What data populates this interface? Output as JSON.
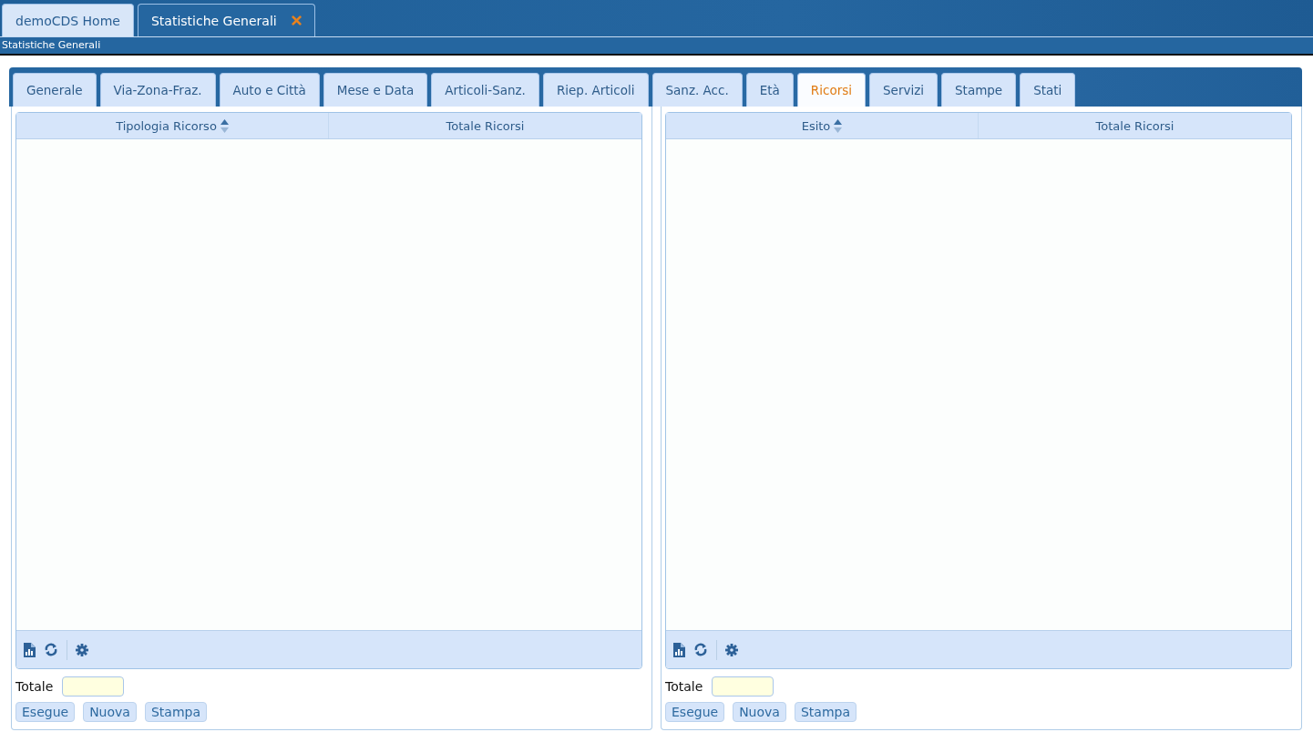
{
  "window_tabs": [
    {
      "label": "demoCDS Home",
      "selected": false,
      "closable": false
    },
    {
      "label": "Statistiche Generali",
      "selected": true,
      "closable": true
    }
  ],
  "breadcrumb": "Statistiche Generali",
  "tabs": [
    {
      "label": "Generale",
      "selected": false
    },
    {
      "label": "Via-Zona-Fraz.",
      "selected": false
    },
    {
      "label": "Auto e Città",
      "selected": false
    },
    {
      "label": "Mese e Data",
      "selected": false
    },
    {
      "label": "Articoli-Sanz.",
      "selected": false
    },
    {
      "label": "Riep. Articoli",
      "selected": false
    },
    {
      "label": "Sanz. Acc.",
      "selected": false
    },
    {
      "label": "Età",
      "selected": false
    },
    {
      "label": "Ricorsi",
      "selected": true
    },
    {
      "label": "Servizi",
      "selected": false
    },
    {
      "label": "Stampe",
      "selected": false
    },
    {
      "label": "Stati",
      "selected": false
    }
  ],
  "panels": [
    {
      "columns": [
        {
          "label": "Tipologia Ricorso",
          "sortable": true
        },
        {
          "label": "Totale Ricorsi",
          "sortable": false
        }
      ],
      "total_label": "Totale",
      "buttons": [
        "Esegue",
        "Nuova",
        "Stampa"
      ]
    },
    {
      "columns": [
        {
          "label": "Esito",
          "sortable": true
        },
        {
          "label": "Totale Ricorsi",
          "sortable": false
        }
      ],
      "total_label": "Totale",
      "buttons": [
        "Esegue",
        "Nuova",
        "Stampa"
      ]
    }
  ]
}
